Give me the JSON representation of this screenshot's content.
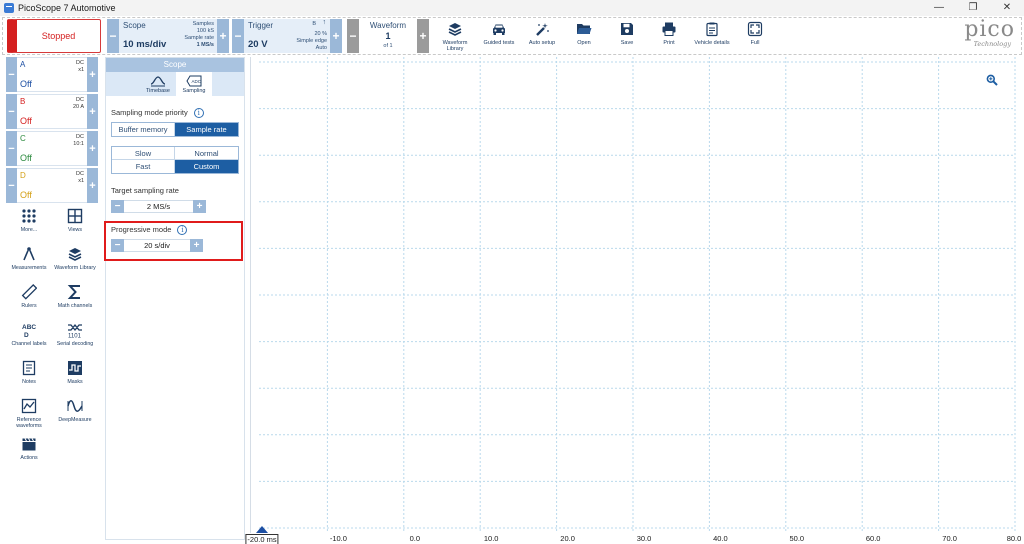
{
  "window": {
    "title": "PicoScope 7 Automotive",
    "controls": [
      "—",
      "❐",
      "✕"
    ]
  },
  "toolbar": {
    "status": "Stopped",
    "scope": {
      "title": "Scope",
      "value": "10 ms/div",
      "samples_label": "Samples",
      "samples_value": "100 kS",
      "rate_label": "Sample rate",
      "rate_value": "1 MS/s"
    },
    "trigger": {
      "title": "Trigger",
      "value": "20 V",
      "channel": "B",
      "edge_symbol": "↑",
      "percent": "20 %",
      "type": "Simple edge",
      "mode": "Auto"
    },
    "waveform": {
      "title": "Waveform",
      "value": "1",
      "of": "of 1"
    },
    "tools": [
      {
        "label": "Waveform Library",
        "icon": "waveform-library-icon"
      },
      {
        "label": "Guided tests",
        "icon": "car-icon"
      },
      {
        "label": "Auto setup",
        "icon": "magic-wand-icon"
      },
      {
        "label": "Open",
        "icon": "folder-icon"
      },
      {
        "label": "Save",
        "icon": "save-icon"
      },
      {
        "label": "Print",
        "icon": "printer-icon"
      },
      {
        "label": "Vehicle details",
        "icon": "clipboard-icon"
      },
      {
        "label": "Full",
        "icon": "fullscreen-icon"
      }
    ],
    "logo": {
      "big": "pico",
      "small": "Technology"
    }
  },
  "channels": [
    {
      "name": "A",
      "coupling": "DC",
      "range": "x1",
      "state": "Off",
      "color": "#1d4fa3"
    },
    {
      "name": "B",
      "coupling": "DC",
      "range": "20 A",
      "state": "Off",
      "color": "#d41f1f"
    },
    {
      "name": "C",
      "coupling": "DC",
      "range": "10:1",
      "state": "Off",
      "color": "#2b8a3e"
    },
    {
      "name": "D",
      "coupling": "DC",
      "range": "x1",
      "state": "Off",
      "color": "#d4a017"
    }
  ],
  "side_tools": [
    {
      "label": "More...",
      "icon": "grid-dots-icon"
    },
    {
      "label": "Views",
      "icon": "views-icon"
    },
    {
      "label": "Measurements",
      "icon": "compass-icon"
    },
    {
      "label": "Waveform Library",
      "icon": "waveform-library-icon"
    },
    {
      "label": "Rulers",
      "icon": "ruler-icon"
    },
    {
      "label": "Math channels",
      "icon": "sigma-icon"
    },
    {
      "label": "Channel labels",
      "icon": "abcd-icon"
    },
    {
      "label": "Serial decoding",
      "icon": "serial-decode-icon"
    },
    {
      "label": "Notes",
      "icon": "notes-icon"
    },
    {
      "label": "Masks",
      "icon": "masks-icon"
    },
    {
      "label": "Reference waveforms",
      "icon": "reference-waveform-icon"
    },
    {
      "label": "DeepMeasure",
      "icon": "deepmeasure-icon"
    },
    {
      "label": "Actions",
      "icon": "clapperboard-icon"
    }
  ],
  "panel": {
    "title": "Scope",
    "tabs": [
      {
        "label": "Timebase",
        "icon": "timebase-icon"
      },
      {
        "label": "Sampling",
        "icon": "adc-icon"
      }
    ],
    "priority_label": "Sampling mode priority",
    "priority_options": [
      "Buffer memory",
      "Sample rate"
    ],
    "priority_selected": "Sample rate",
    "speed_options": [
      "Slow",
      "Normal",
      "Fast",
      "Custom"
    ],
    "speed_selected": "Custom",
    "target_rate_label": "Target sampling rate",
    "target_rate_value": "2 MS/s",
    "progressive_label": "Progressive mode",
    "progressive_value": "20 s/div",
    "info_glyph": "i",
    "minus": "−",
    "plus": "+"
  },
  "graph": {
    "x_ticks": [
      "-20.0",
      "-10.0",
      "0.0",
      "10.0",
      "20.0",
      "30.0",
      "40.0",
      "50.0",
      "60.0",
      "70.0",
      "80.0"
    ],
    "x_unit": "ms",
    "grid_color": "#b9d9ec"
  }
}
